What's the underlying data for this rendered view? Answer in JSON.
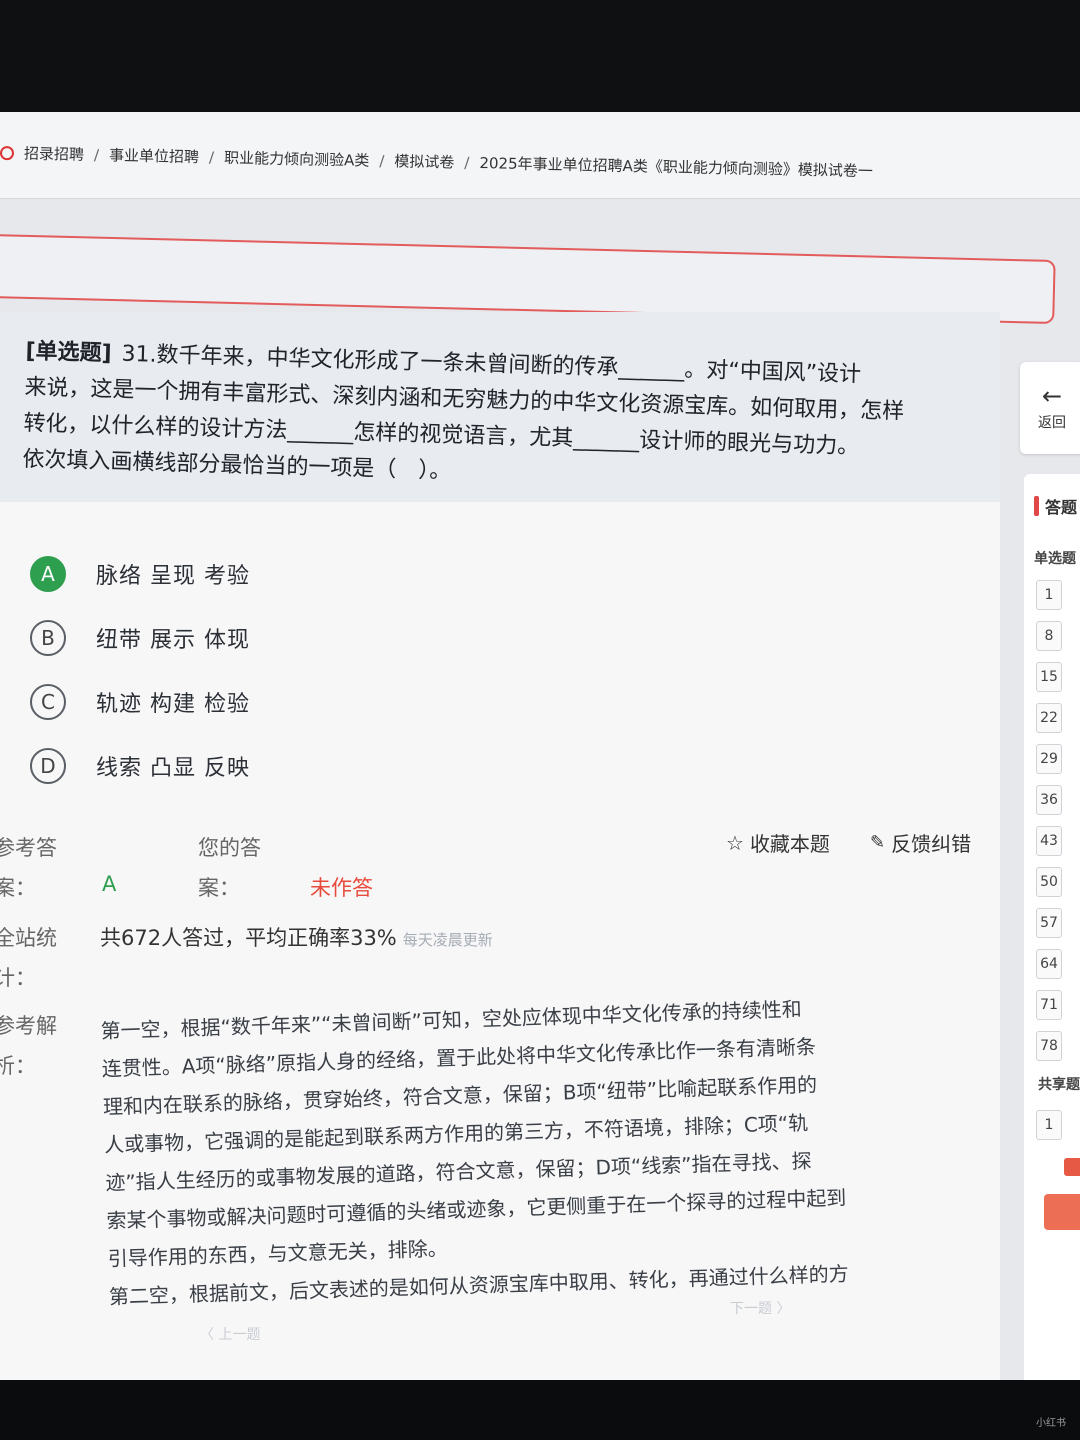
{
  "breadcrumb": {
    "items": [
      "招录招聘",
      "事业单位招聘",
      "职业能力倾向测验A类",
      "模拟试卷",
      "2025年事业单位招聘A类《职业能力倾向测验》模拟试卷一"
    ],
    "separator": "/"
  },
  "question": {
    "tag": "[单选题]",
    "line1": "31.数千年来，中华文化形成了一条未曾间断的传承______。对“中国风”设计",
    "line2": "来说，这是一个拥有丰富形式、深刻内涵和无穷魅力的中华文化资源宝库。如何取用，怎样",
    "line3": "转化，以什么样的设计方法______怎样的视觉语言，尤其______设计师的眼光与功力。",
    "line4": "依次填入画横线部分最恰当的一项是（　）。"
  },
  "options": [
    {
      "letter": "A",
      "text": "脉络 呈现 考验",
      "selected": true
    },
    {
      "letter": "B",
      "text": "纽带 展示 体现",
      "selected": false
    },
    {
      "letter": "C",
      "text": "轨迹 构建 检验",
      "selected": false
    },
    {
      "letter": "D",
      "text": "线索 凸显 反映",
      "selected": false
    }
  ],
  "answer": {
    "ref_label_1": "参考答",
    "ref_label_2": "案：",
    "ref_value": "A",
    "your_label_1": "您的答",
    "your_label_2": "案：",
    "your_value": "未作答",
    "favorite": "收藏本题",
    "feedback": "反馈纠错",
    "stats_label_1": "全站统",
    "stats_label_2": "计：",
    "stats_text": "共672人答过，平均正确率33%",
    "stats_note": "每天凌晨更新",
    "analysis_label_1": "参考解",
    "analysis_label_2": "析：",
    "analysis_lines": [
      "第一空，根据“数千年来”“未曾间断”可知，空处应体现中华文化传承的持续性和",
      "连贯性。A项“脉络”原指人身的经络，置于此处将中华文化传承比作一条有清晰条",
      "理和内在联系的脉络，贯穿始终，符合文意，保留；B项“纽带”比喻起联系作用的",
      "人或事物，它强调的是能起到联系两方作用的第三方，不符语境，排除；C项“轨",
      "迹”指人生经历的或事物发展的道路，符合文意，保留；D项“线索”指在寻找、探",
      "索某个事物或解决问题时可遵循的头绪或迹象，它更侧重于在一个探寻的过程中起到",
      "引导作用的东西，与文意无关，排除。",
      "第二空，根据前文，后文表述的是如何从资源宝库中取用、转化，再通过什么样的方"
    ]
  },
  "navigation": {
    "prev": "〈 上一题",
    "next": "下一题 〉"
  },
  "sidebar": {
    "back_label": "返回",
    "sheet_title": "答题",
    "section_single": "单选题",
    "numbers": [
      "1",
      "8",
      "15",
      "22",
      "29",
      "36",
      "43",
      "50",
      "57",
      "64",
      "71",
      "78"
    ],
    "section_shared": "共享题",
    "shared_numbers": [
      "1"
    ]
  },
  "watermark": "小红书",
  "colors": {
    "accent_green": "#2e9e4f",
    "unanswered_red": "#e84a3c",
    "border_red": "#e35b5b"
  }
}
